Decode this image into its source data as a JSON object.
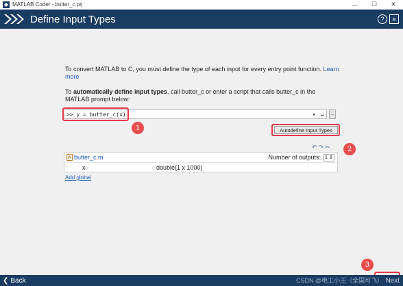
{
  "window": {
    "title": "MATLAB Coder - butter_c.prj",
    "minimize": "—",
    "maximize": "☐",
    "close": "✕"
  },
  "header": {
    "title": "Define Input Types",
    "help": "?",
    "menu": "≡"
  },
  "content": {
    "intro_text": "To convert MATLAB to C, you must define the type of each input for every entry point function.",
    "learn_more": "Learn more",
    "intro2_prefix": "To ",
    "intro2_bold": "automatically define input types",
    "intro2_suffix": ", call butter_c or enter a script that calls butter_c in the MATLAB prompt below:",
    "prompt_value": ">>  y  = butter_c(x)",
    "prompt_dropdown": "▾",
    "prompt_enter": "↵",
    "browse": "...",
    "autodefine_button": "Autodefine Input Types"
  },
  "annotations": {
    "badge1": "1",
    "badge2": "2",
    "badge3": "3"
  },
  "types_table": {
    "file_name": "butter_c.m",
    "outputs_label": "Number of outputs:",
    "outputs_value": "1",
    "rows": [
      {
        "name": "x",
        "type": "double(1 x 1000)"
      }
    ],
    "add_global": "Add global"
  },
  "footer": {
    "back": "Back",
    "next": "Next",
    "watermark": "CSDN @电工小王（全国可飞）"
  }
}
